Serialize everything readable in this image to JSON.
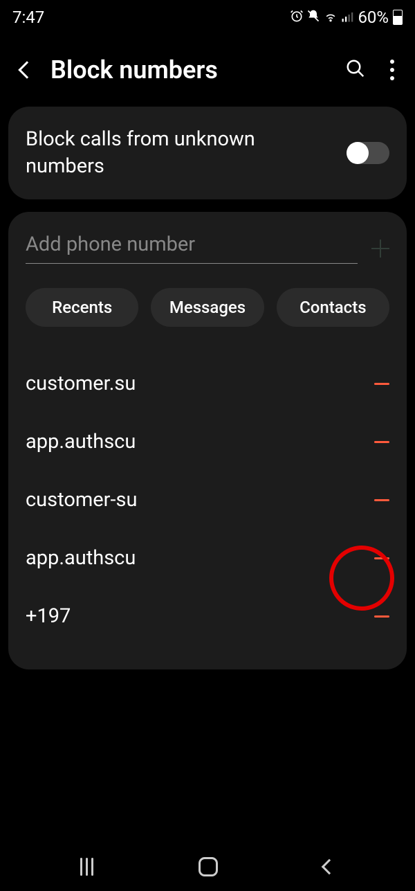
{
  "status": {
    "time": "7:47",
    "battery": "60%"
  },
  "header": {
    "title": "Block numbers"
  },
  "toggle_card": {
    "label": "Block calls from unknown numbers"
  },
  "input": {
    "placeholder": "Add phone number"
  },
  "chips": {
    "recents": "Recents",
    "messages": "Messages",
    "contacts": "Contacts"
  },
  "blocked_list": [
    {
      "label": "customer.su"
    },
    {
      "label": "app.authscu"
    },
    {
      "label": "customer-su"
    },
    {
      "label": "app.authscu"
    },
    {
      "label": "+197"
    }
  ]
}
